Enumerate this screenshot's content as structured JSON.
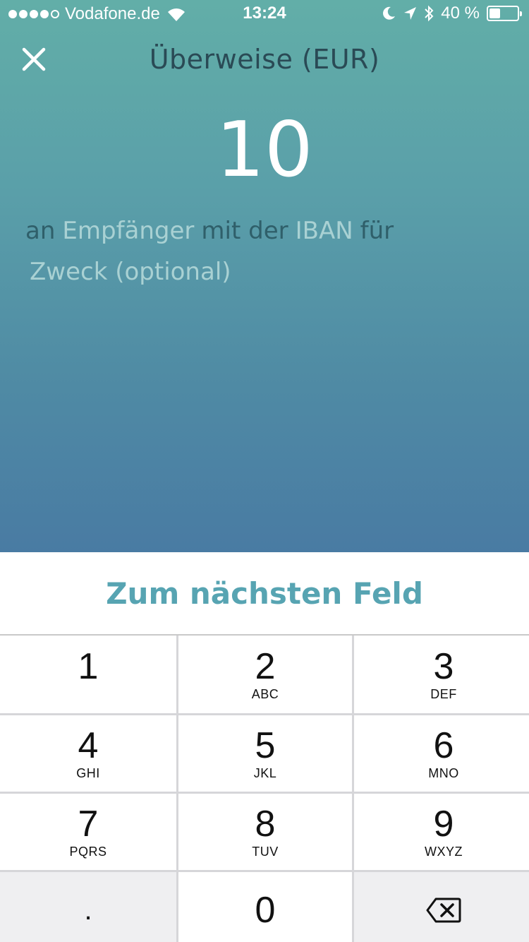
{
  "status_bar": {
    "carrier": "Vodafone.de",
    "time": "13:24",
    "battery_percent": "40 %",
    "battery_level": 0.4,
    "icons": [
      "signal-dots-icon",
      "wifi-icon",
      "moon-icon",
      "location-arrow-icon",
      "bluetooth-icon",
      "battery-icon"
    ]
  },
  "header": {
    "title": "Überweise (EUR)",
    "close_icon": "close-icon"
  },
  "form": {
    "amount": "10",
    "word_an": "an",
    "recipient_placeholder": "Empfänger",
    "word_mit_der": "mit der",
    "iban_placeholder": "IBAN",
    "word_fuer": "für",
    "purpose_placeholder": "Zweck (optional)"
  },
  "next_field_label": "Zum nächsten Feld",
  "keypad": {
    "keys": [
      {
        "digit": "1",
        "letters": ""
      },
      {
        "digit": "2",
        "letters": "ABC"
      },
      {
        "digit": "3",
        "letters": "DEF"
      },
      {
        "digit": "4",
        "letters": "GHI"
      },
      {
        "digit": "5",
        "letters": "JKL"
      },
      {
        "digit": "6",
        "letters": "MNO"
      },
      {
        "digit": "7",
        "letters": "PQRS"
      },
      {
        "digit": "8",
        "letters": "TUV"
      },
      {
        "digit": "9",
        "letters": "WXYZ"
      }
    ],
    "decimal": ".",
    "zero": "0",
    "delete_icon": "backspace-icon"
  },
  "colors": {
    "gradient_top": "#62aea8",
    "gradient_bottom": "#497ba3",
    "accent": "#57a4b2",
    "title_text": "#2a4a55",
    "placeholder_text": "#a9d1d3"
  }
}
